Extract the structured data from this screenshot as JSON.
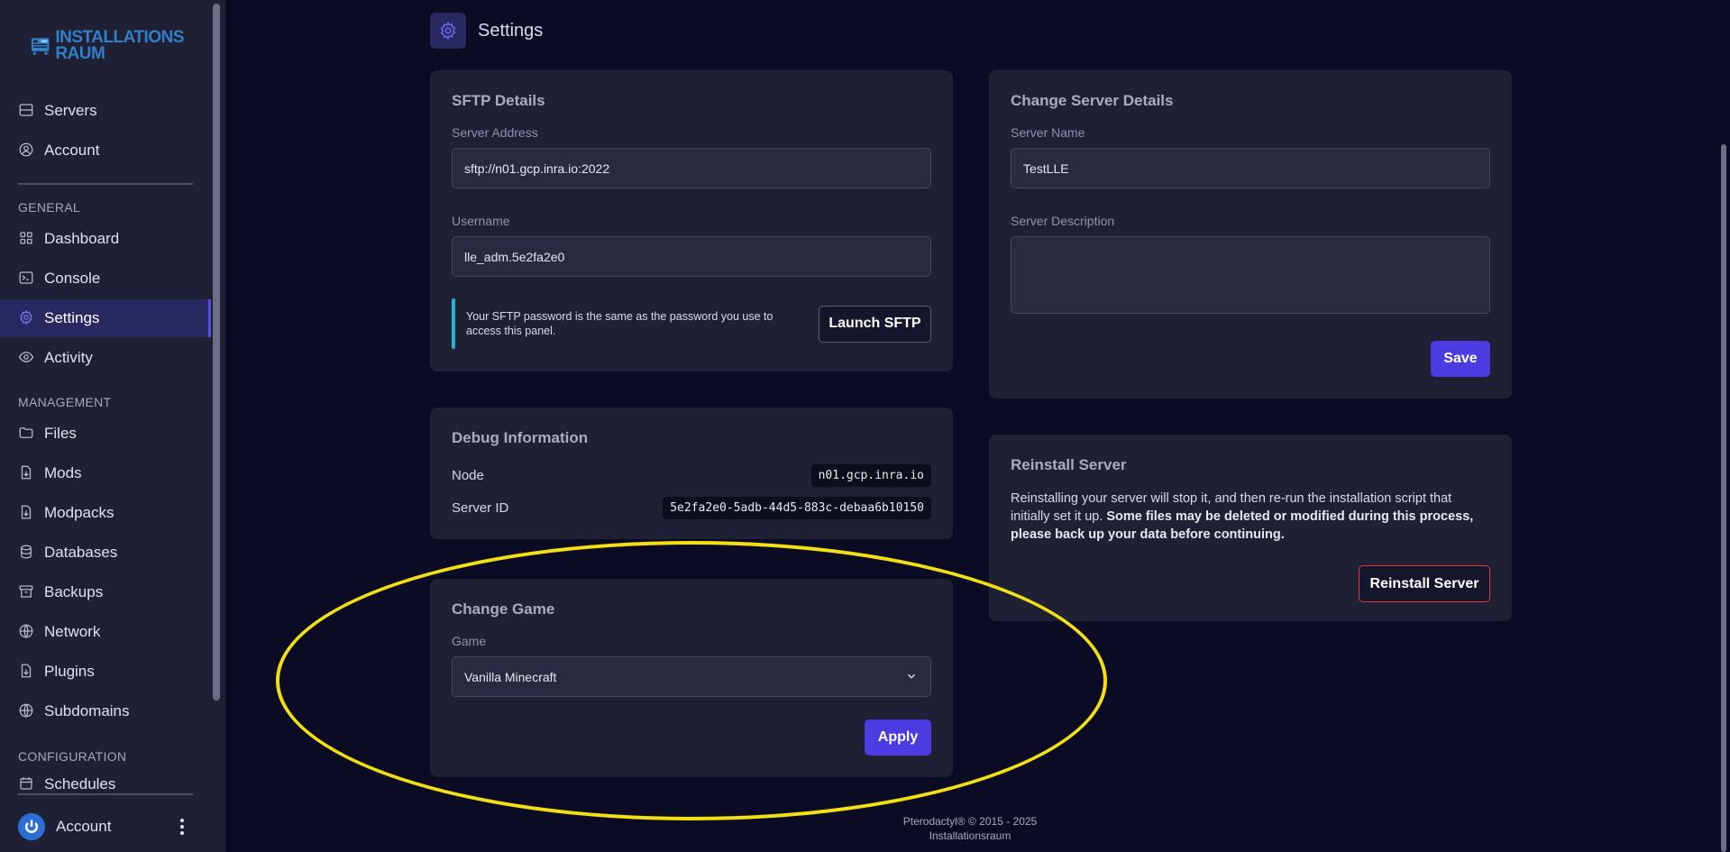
{
  "brand": {
    "logo_text_line1": "INSTALLATIONS",
    "logo_text_line2": "RAUM",
    "accent_color": "#4b3be0"
  },
  "sidebar": {
    "top_items": [
      {
        "label": "Servers",
        "icon": "server-icon"
      },
      {
        "label": "Account",
        "icon": "user-circle-icon"
      }
    ],
    "sections": {
      "general": "GENERAL",
      "management": "MANAGEMENT",
      "configuration": "CONFIGURATION"
    },
    "general_items": [
      {
        "label": "Dashboard",
        "icon": "grid-icon"
      },
      {
        "label": "Console",
        "icon": "terminal-icon"
      },
      {
        "label": "Settings",
        "icon": "gear-icon",
        "active": true
      },
      {
        "label": "Activity",
        "icon": "eye-icon"
      }
    ],
    "management_items": [
      {
        "label": "Files",
        "icon": "folder-icon"
      },
      {
        "label": "Mods",
        "icon": "file-download-icon"
      },
      {
        "label": "Modpacks",
        "icon": "file-download-icon"
      },
      {
        "label": "Databases",
        "icon": "database-icon"
      },
      {
        "label": "Backups",
        "icon": "archive-icon"
      },
      {
        "label": "Network",
        "icon": "globe-icon"
      },
      {
        "label": "Plugins",
        "icon": "file-download-icon"
      },
      {
        "label": "Subdomains",
        "icon": "globe-icon"
      }
    ],
    "configuration_items": [
      {
        "label": "Schedules",
        "icon": "calendar-icon"
      }
    ],
    "account": {
      "label": "Account"
    }
  },
  "page": {
    "title": "Settings"
  },
  "sftp": {
    "title": "SFTP Details",
    "address_label": "Server Address",
    "address_value": "sftp://n01.gcp.inra.io:2022",
    "username_label": "Username",
    "username_value": "lle_adm.5e2fa2e0",
    "note": "Your SFTP password is the same as the password you use to access this panel.",
    "launch_button": "Launch SFTP"
  },
  "debug": {
    "title": "Debug Information",
    "node_label": "Node",
    "node_value": "n01.gcp.inra.io",
    "server_id_label": "Server ID",
    "server_id_value": "5e2fa2e0-5adb-44d5-883c-debaa6b10150"
  },
  "change_game": {
    "title": "Change Game",
    "game_label": "Game",
    "game_value": "Vanilla Minecraft",
    "apply_button": "Apply"
  },
  "server_details": {
    "title": "Change Server Details",
    "name_label": "Server Name",
    "name_value": "TestLLE",
    "description_label": "Server Description",
    "description_value": "",
    "save_button": "Save"
  },
  "reinstall": {
    "title": "Reinstall Server",
    "text_plain": "Reinstalling your server will stop it, and then re-run the installation script that initially set it up. ",
    "text_bold": "Some files may be deleted or modified during this process, please back up your data before continuing.",
    "button": "Reinstall Server"
  },
  "footer": {
    "line1": "Pterodactyl® © 2015 - 2025",
    "line2": "Installationsraum"
  },
  "annotation": {
    "highlight_color": "#f2e012"
  }
}
